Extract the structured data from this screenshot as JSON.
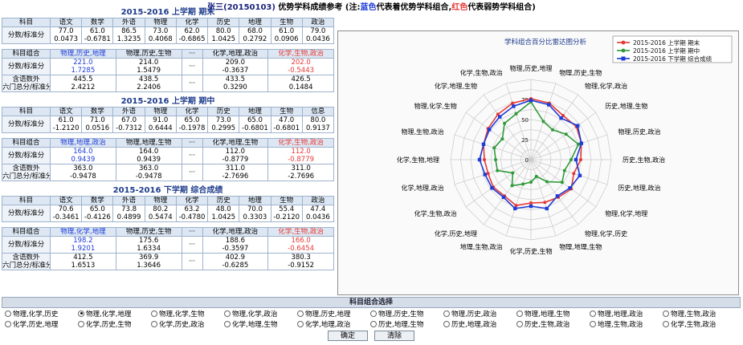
{
  "header": {
    "student": "张三(20150103)",
    "title": "优势学科成绩参考",
    "note_prefix": "(注:",
    "note_blue": "蓝色",
    "note_mid": "代表着优势学科组合,",
    "note_red": "红色",
    "note_suffix": "代表弱势学科组合)"
  },
  "sections": [
    {
      "title": "2015-2016 上学期 期末",
      "subject_label": "科目",
      "score_label": "分数/标准分",
      "subjects": [
        "语文",
        "数学",
        "外语",
        "物理",
        "化学",
        "历史",
        "地理",
        "生物",
        "政治"
      ],
      "scores": [
        "77.0",
        "61.0",
        "86.5",
        "73.0",
        "62.0",
        "80.0",
        "68.0",
        "61.0",
        "79.0"
      ],
      "stds": [
        "0.0473",
        "-0.6781",
        "1.3235",
        "0.4068",
        "-0.6865",
        "1.0425",
        "0.2792",
        "0.0906",
        "0.0436"
      ],
      "combo_label": "科目组合",
      "combos": [
        {
          "name": "物理,历史,地理",
          "score": "221.0",
          "std": "1.7285",
          "color": "blue"
        },
        {
          "name": "物理,历史,生物",
          "score": "214.0",
          "std": "1.5479",
          "color": "none"
        },
        {
          "name": "化学,地理,政治",
          "score": "209.0",
          "std": "-0.3637",
          "color": "none"
        },
        {
          "name": "化学,生物,政治",
          "score": "202.0",
          "std": "-0.5443",
          "color": "red"
        }
      ],
      "ellipsis": "···",
      "total_label1": "含语数外",
      "total_label2": "六门总分/标准分",
      "totals": [
        {
          "score": "445.5",
          "std": "2.4212"
        },
        {
          "score": "438.5",
          "std": "2.2406"
        },
        {
          "score": "433.5",
          "std": "0.3290"
        },
        {
          "score": "426.5",
          "std": "0.1484"
        }
      ]
    },
    {
      "title": "2015-2016 上学期 期中",
      "subject_label": "科目",
      "score_label": "分数/标准分",
      "subjects": [
        "语文",
        "数学",
        "外语",
        "物理",
        "化学",
        "历史",
        "地理",
        "生物",
        "信息"
      ],
      "scores": [
        "61.0",
        "71.0",
        "67.0",
        "91.0",
        "65.0",
        "73.0",
        "65.0",
        "47.0",
        "80.0"
      ],
      "stds": [
        "-1.2120",
        "0.0516",
        "-0.7312",
        "0.6444",
        "-0.1978",
        "0.2995",
        "-0.6801",
        "-0.6801",
        "0.9137"
      ],
      "combo_label": "科目组合",
      "combos": [
        {
          "name": "物理,地理,政治",
          "score": "164.0",
          "std": "0.9439",
          "color": "blue"
        },
        {
          "name": "物理,地理,生物",
          "score": "164.0",
          "std": "0.9439",
          "color": "none"
        },
        {
          "name": "化学,地理,生物",
          "score": "112.0",
          "std": "-0.8779",
          "color": "none"
        },
        {
          "name": "化学,生物,政治",
          "score": "112.0",
          "std": "-0.8779",
          "color": "red"
        }
      ],
      "ellipsis": "···",
      "total_label1": "含语数外",
      "total_label2": "六门总分/标准分",
      "totals": [
        {
          "score": "363.0",
          "std": "-0.9478"
        },
        {
          "score": "363.0",
          "std": "-0.9478"
        },
        {
          "score": "311.0",
          "std": "-2.7696"
        },
        {
          "score": "311.0",
          "std": "-2.7696"
        }
      ]
    },
    {
      "title": "2015-2016 下学期 综合成绩",
      "subject_label": "科目",
      "score_label": "分数/标准分",
      "subjects": [
        "语文",
        "数学",
        "外语",
        "物理",
        "化学",
        "历史",
        "地理",
        "生物",
        "政治"
      ],
      "scores": [
        "70.6",
        "65.0",
        "73.8",
        "80.2",
        "63.2",
        "48.0",
        "70.0",
        "55.4",
        "47.4"
      ],
      "stds": [
        "-0.3461",
        "-0.4126",
        "0.4899",
        "0.5474",
        "-0.4780",
        "1.0425",
        "0.3303",
        "-0.2120",
        "0.0436"
      ],
      "combo_label": "科目组合",
      "combos": [
        {
          "name": "物理,化学,地理",
          "score": "198.2",
          "std": "1.9201",
          "color": "blue"
        },
        {
          "name": "物理,历史,生物",
          "score": "175.6",
          "std": "1.6334",
          "color": "none"
        },
        {
          "name": "化学,地理,政治",
          "score": "188.6",
          "std": "-0.3597",
          "color": "none"
        },
        {
          "name": "化学,生物,政治",
          "score": "166.0",
          "std": "-0.6454",
          "color": "red"
        }
      ],
      "ellipsis": "···",
      "total_label1": "含语数外",
      "total_label2": "六门总分/标准分",
      "totals": [
        {
          "score": "412.5",
          "std": "1.6513"
        },
        {
          "score": "369.9",
          "std": "1.3646"
        },
        {
          "score": "402.9",
          "std": "-0.6285"
        },
        {
          "score": "380.3",
          "std": "-0.9152"
        }
      ]
    }
  ],
  "chart_data": {
    "type": "radar",
    "title": "学科组合百分比雷达图分析",
    "categories": [
      "物理,历史,地理",
      "物理,历史,生物",
      "物理,化学,政治",
      "历史,地理,生物",
      "物理,历史,政治",
      "历史,生物,政治",
      "历史,地理,政治",
      "物理,化学,地理",
      "物理,化学,历史",
      "物理,地理,生物",
      "化学,历史,生物",
      "地理,生物,政治",
      "化学,历史,地理",
      "化学,生物,政治",
      "化学,地理,政治",
      "化学,生物,地理",
      "物理,生物,政治",
      "物理,化学,生物",
      "化学,地理,生物",
      "化学,生物,政治"
    ],
    "series": [
      {
        "name": "2015-2016 上学期 期末",
        "color": "#e53935",
        "values": [
          76,
          74,
          68,
          70,
          66,
          62,
          56,
          62,
          58,
          56,
          54,
          60,
          56,
          58,
          56,
          58,
          62,
          66,
          70,
          74
        ]
      },
      {
        "name": "2015-2016 上学期 期中",
        "color": "#2e9a3a",
        "values": [
          72,
          50,
          46,
          54,
          62,
          50,
          44,
          48,
          34,
          22,
          28,
          32,
          40,
          28,
          44,
          44,
          48,
          44,
          56,
          60
        ]
      },
      {
        "name": "2015-2016 下学期 综合成绩",
        "color": "#1e3cd8",
        "values": [
          74,
          72,
          64,
          72,
          66,
          56,
          64,
          60,
          56,
          64,
          58,
          64,
          58,
          60,
          60,
          64,
          62,
          64,
          66,
          70
        ]
      }
    ],
    "r_ticks": [
      0,
      25,
      50,
      75
    ],
    "rlim": [
      0,
      100
    ],
    "legend": "top-right",
    "grid": true
  },
  "combo_select": {
    "title": "科目组合选择",
    "options": [
      {
        "label": "物理,化学,历史",
        "checked": false
      },
      {
        "label": "物理,化学,地理",
        "checked": true
      },
      {
        "label": "物理,化学,生物",
        "checked": false
      },
      {
        "label": "物理,化学,政治",
        "checked": false
      },
      {
        "label": "物理,历史,地理",
        "checked": false
      },
      {
        "label": "物理,历史,生物",
        "checked": false
      },
      {
        "label": "物理,历史,政治",
        "checked": false
      },
      {
        "label": "物理,地理,生物",
        "checked": false
      },
      {
        "label": "物理,地理,政治",
        "checked": false
      },
      {
        "label": "物理,生物,政治",
        "checked": false
      },
      {
        "label": "化学,历史,地理",
        "checked": false
      },
      {
        "label": "化学,历史,生物",
        "checked": false
      },
      {
        "label": "化学,历史,政治",
        "checked": false
      },
      {
        "label": "化学,地理,生物",
        "checked": false
      },
      {
        "label": "化学,地理,政治",
        "checked": false
      },
      {
        "label": "历史,地理,生物",
        "checked": false
      },
      {
        "label": "历史,地理,政治",
        "checked": false
      },
      {
        "label": "历史,生物,政治",
        "checked": false
      },
      {
        "label": "地理,生物,政治",
        "checked": false
      },
      {
        "label": "化学,生物,政治",
        "checked": false
      }
    ],
    "confirm_label": "确定",
    "clear_label": "清除"
  }
}
